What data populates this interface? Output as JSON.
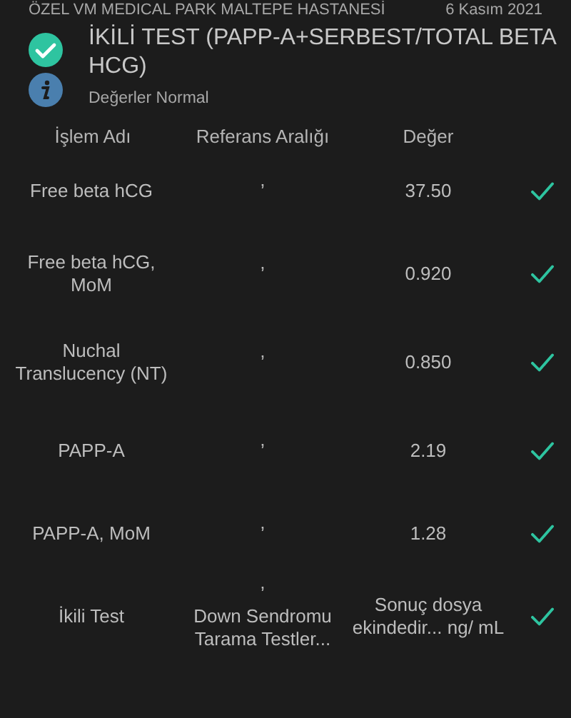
{
  "header": {
    "hospital": "ÖZEL VM MEDICAL PARK MALTEPE HASTANESİ",
    "date": "6 Kasım 2021",
    "title": "İKİLİ TEST (PAPP-A+SERBEST/TOTAL BETA HCG)",
    "normal": true,
    "summary": "Değerler Normal"
  },
  "table": {
    "columns": [
      "İşlem Adı",
      "Referans Aralığı",
      "Değer"
    ],
    "rows": [
      {
        "name": "Free beta hCG",
        "reference": "’",
        "value": "37.50",
        "normal": true
      },
      {
        "name": "Free beta hCG, MoM",
        "reference": "’",
        "value": "0.920",
        "normal": true
      },
      {
        "name": "Nuchal Translucency (NT)",
        "reference": "’",
        "value": "0.850",
        "normal": true
      },
      {
        "name": "PAPP-A",
        "reference": "’",
        "value": "2.19",
        "normal": true
      },
      {
        "name": "PAPP-A, MoM",
        "reference": "’",
        "value": "1.28",
        "normal": true
      },
      {
        "name": "İkili Test",
        "reference": "’\nDown Sendromu Tarama Testler...",
        "value": "Sonuç dosya ekindedir... ng/ mL",
        "normal": true
      }
    ]
  }
}
